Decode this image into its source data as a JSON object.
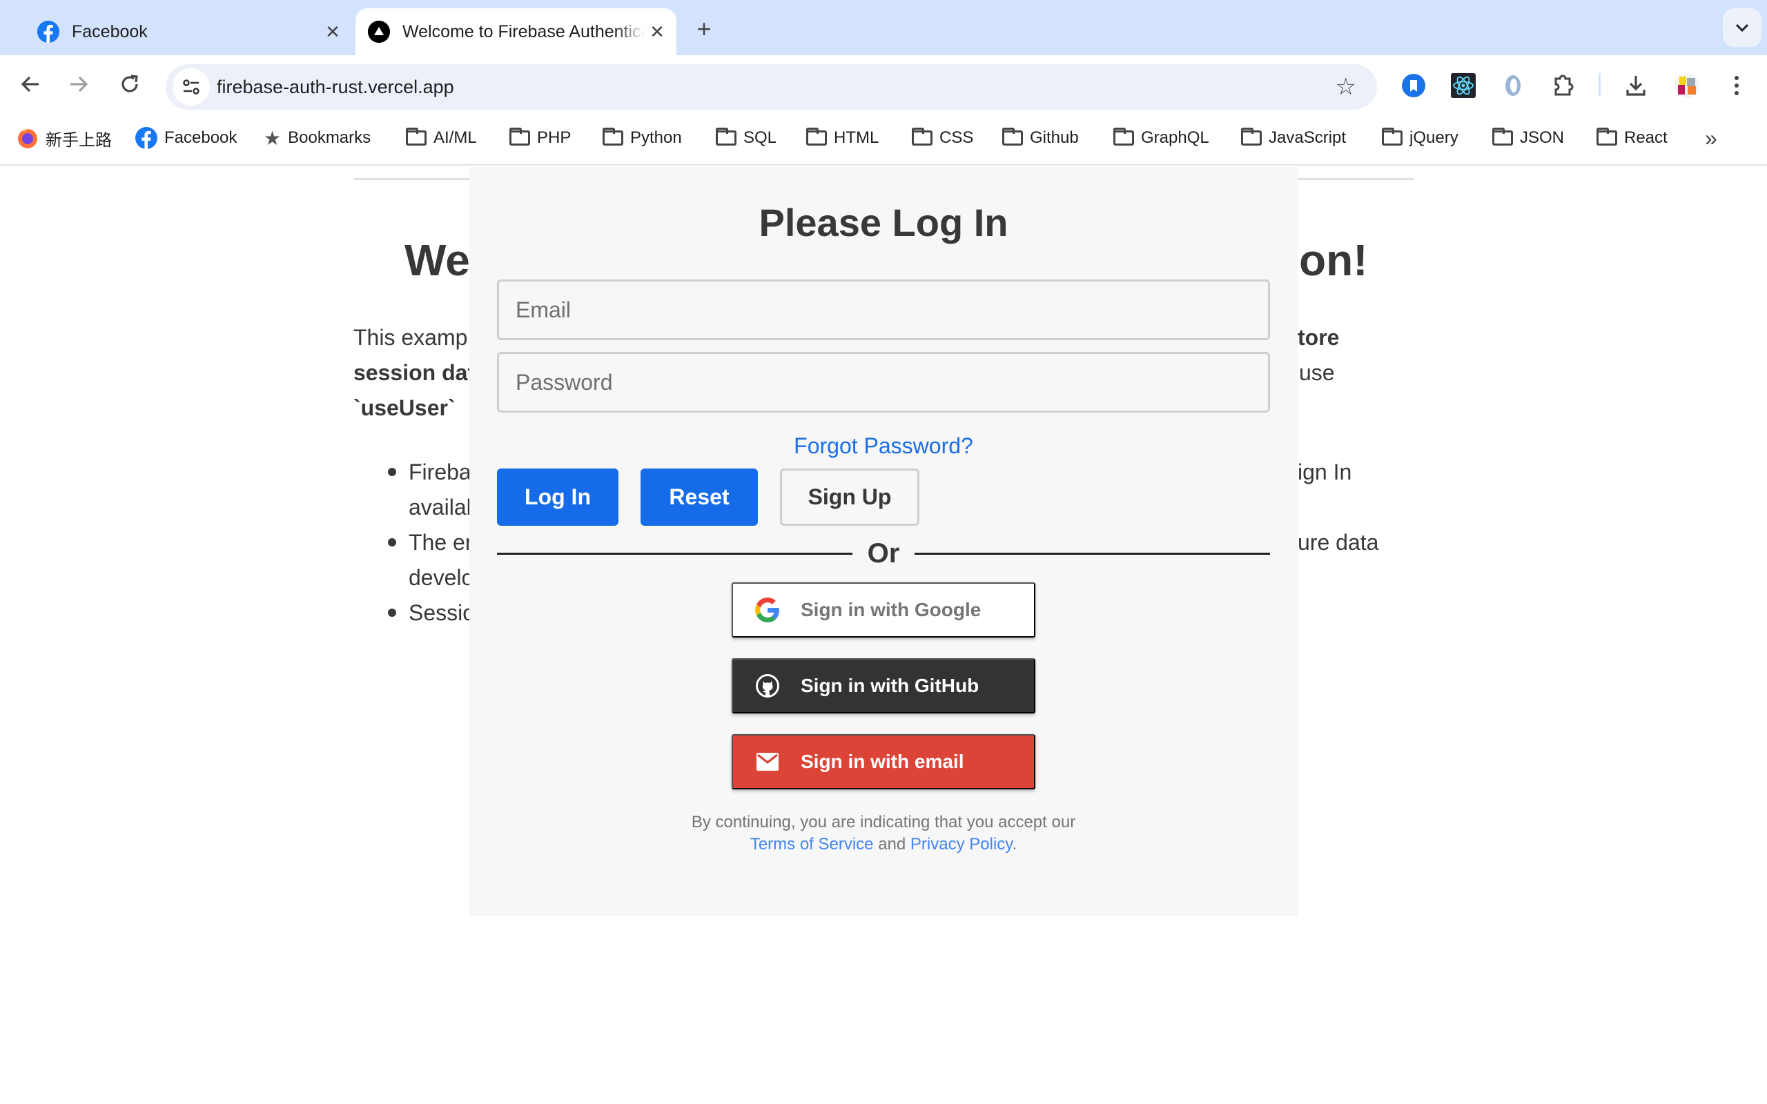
{
  "browser": {
    "tabs": [
      {
        "title": "Facebook",
        "favicon": "facebook-icon",
        "active": false
      },
      {
        "title": "Welcome to Firebase Authentication",
        "favicon": "vercel-triangle-icon",
        "active": true
      }
    ],
    "new_tab_label": "+",
    "tab_search_glyph": "⌄",
    "url": "firebase-auth-rust.vercel.app",
    "colors": {
      "tabstrip": "#d3e3fd",
      "omnibox": "#edf0f8"
    },
    "extensions": [
      "bookmark-extension-icon",
      "react-devtools-icon",
      "json-viewer-icon",
      "extensions-puzzle-icon"
    ],
    "bookmarks": [
      {
        "label": "新手上路",
        "icon": "firefox-icon"
      },
      {
        "label": "Facebook",
        "icon": "facebook-icon"
      },
      {
        "label": "Bookmarks",
        "icon": "star-icon"
      },
      {
        "label": "AI/ML",
        "icon": "folder-icon"
      },
      {
        "label": "PHP",
        "icon": "folder-icon"
      },
      {
        "label": "Python",
        "icon": "folder-icon"
      },
      {
        "label": "SQL",
        "icon": "folder-icon"
      },
      {
        "label": "HTML",
        "icon": "folder-icon"
      },
      {
        "label": "CSS",
        "icon": "folder-icon"
      },
      {
        "label": "Github",
        "icon": "folder-icon"
      },
      {
        "label": "GraphQL",
        "icon": "folder-icon"
      },
      {
        "label": "JavaScript",
        "icon": "folder-icon"
      },
      {
        "label": "jQuery",
        "icon": "folder-icon"
      },
      {
        "label": "JSON",
        "icon": "folder-icon"
      },
      {
        "label": "React",
        "icon": "folder-icon"
      }
    ],
    "bookmarks_overflow": "»"
  },
  "background_page": {
    "heading_left": "We",
    "heading_right": "on!",
    "para_line1_left": "This examp",
    "para_line1_right": "tore",
    "para_line2_left": "session dat",
    "para_line2_right": "use",
    "para_line3_left": "`useUser` ",
    "bullets": [
      {
        "left": "Fireba",
        "right": "ign In"
      },
      {
        "left": "availab",
        "right": ""
      },
      {
        "left": "The en",
        "right": "ure data"
      },
      {
        "left": "develo",
        "right": ""
      },
      {
        "left": "Sessio",
        "right": ""
      }
    ]
  },
  "login_modal": {
    "title": "Please Log In",
    "email_placeholder": "Email",
    "email_value": "",
    "password_placeholder": "Password",
    "password_value": "",
    "forgot_password": "Forgot Password?",
    "login_button": "Log In",
    "reset_button": "Reset",
    "signup_button": "Sign Up",
    "divider_text": "Or",
    "providers": {
      "google": "Sign in with Google",
      "github": "Sign in with GitHub",
      "email": "Sign in with email"
    },
    "tos_prefix": "By continuing, you are indicating that you accept our",
    "tos_link": "Terms of Service",
    "tos_and": "and",
    "privacy_link": "Privacy Policy",
    "tos_suffix": ".",
    "colors": {
      "primary_button": "#166ce8",
      "link": "#1a6ee8",
      "github": "#333333",
      "email_provider": "#db4437",
      "modal_bg": "#f7f7f7"
    }
  }
}
